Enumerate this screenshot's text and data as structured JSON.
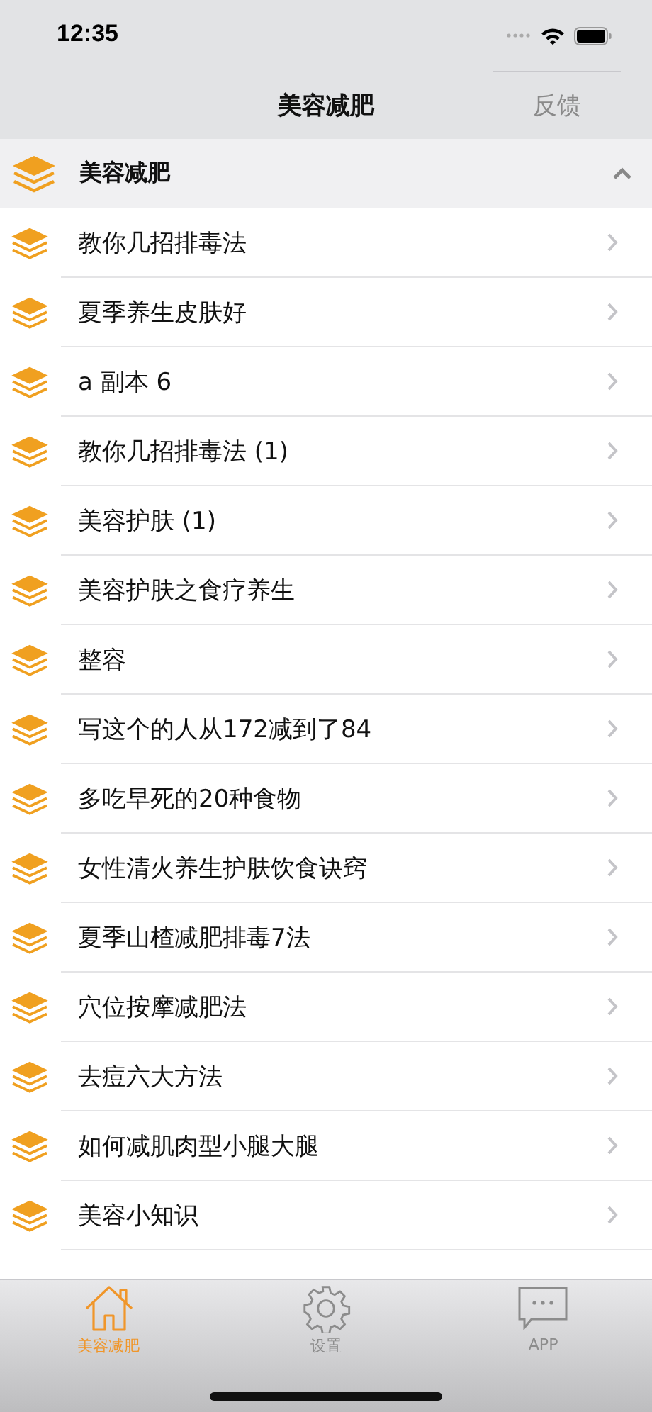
{
  "status_bar": {
    "time": "12:35"
  },
  "nav_bar": {
    "title": "美容减肥",
    "action": "反馈"
  },
  "section": {
    "title": "美容减肥",
    "expanded": true
  },
  "rows": [
    {
      "title": "教你几招排毒法"
    },
    {
      "title": "夏季养生皮肤好"
    },
    {
      "title": "a 副本 6"
    },
    {
      "title": "教你几招排毒法 (1)"
    },
    {
      "title": "美容护肤 (1)"
    },
    {
      "title": "美容护肤之食疗养生"
    },
    {
      "title": "整容"
    },
    {
      "title": "写这个的人从172减到了84"
    },
    {
      "title": "多吃早死的20种食物"
    },
    {
      "title": "女性清火养生护肤饮食诀窍"
    },
    {
      "title": "夏季山楂减肥排毒7法"
    },
    {
      "title": "穴位按摩减肥法"
    },
    {
      "title": "去痘六大方法"
    },
    {
      "title": "如何减肌肉型小腿大腿"
    },
    {
      "title": "美容小知识"
    }
  ],
  "tab_bar": [
    {
      "kind": "home",
      "label": "美容减肥",
      "selected": true
    },
    {
      "kind": "settings",
      "label": "设置",
      "selected": false
    },
    {
      "kind": "chat",
      "label": "APP",
      "selected": false
    }
  ]
}
